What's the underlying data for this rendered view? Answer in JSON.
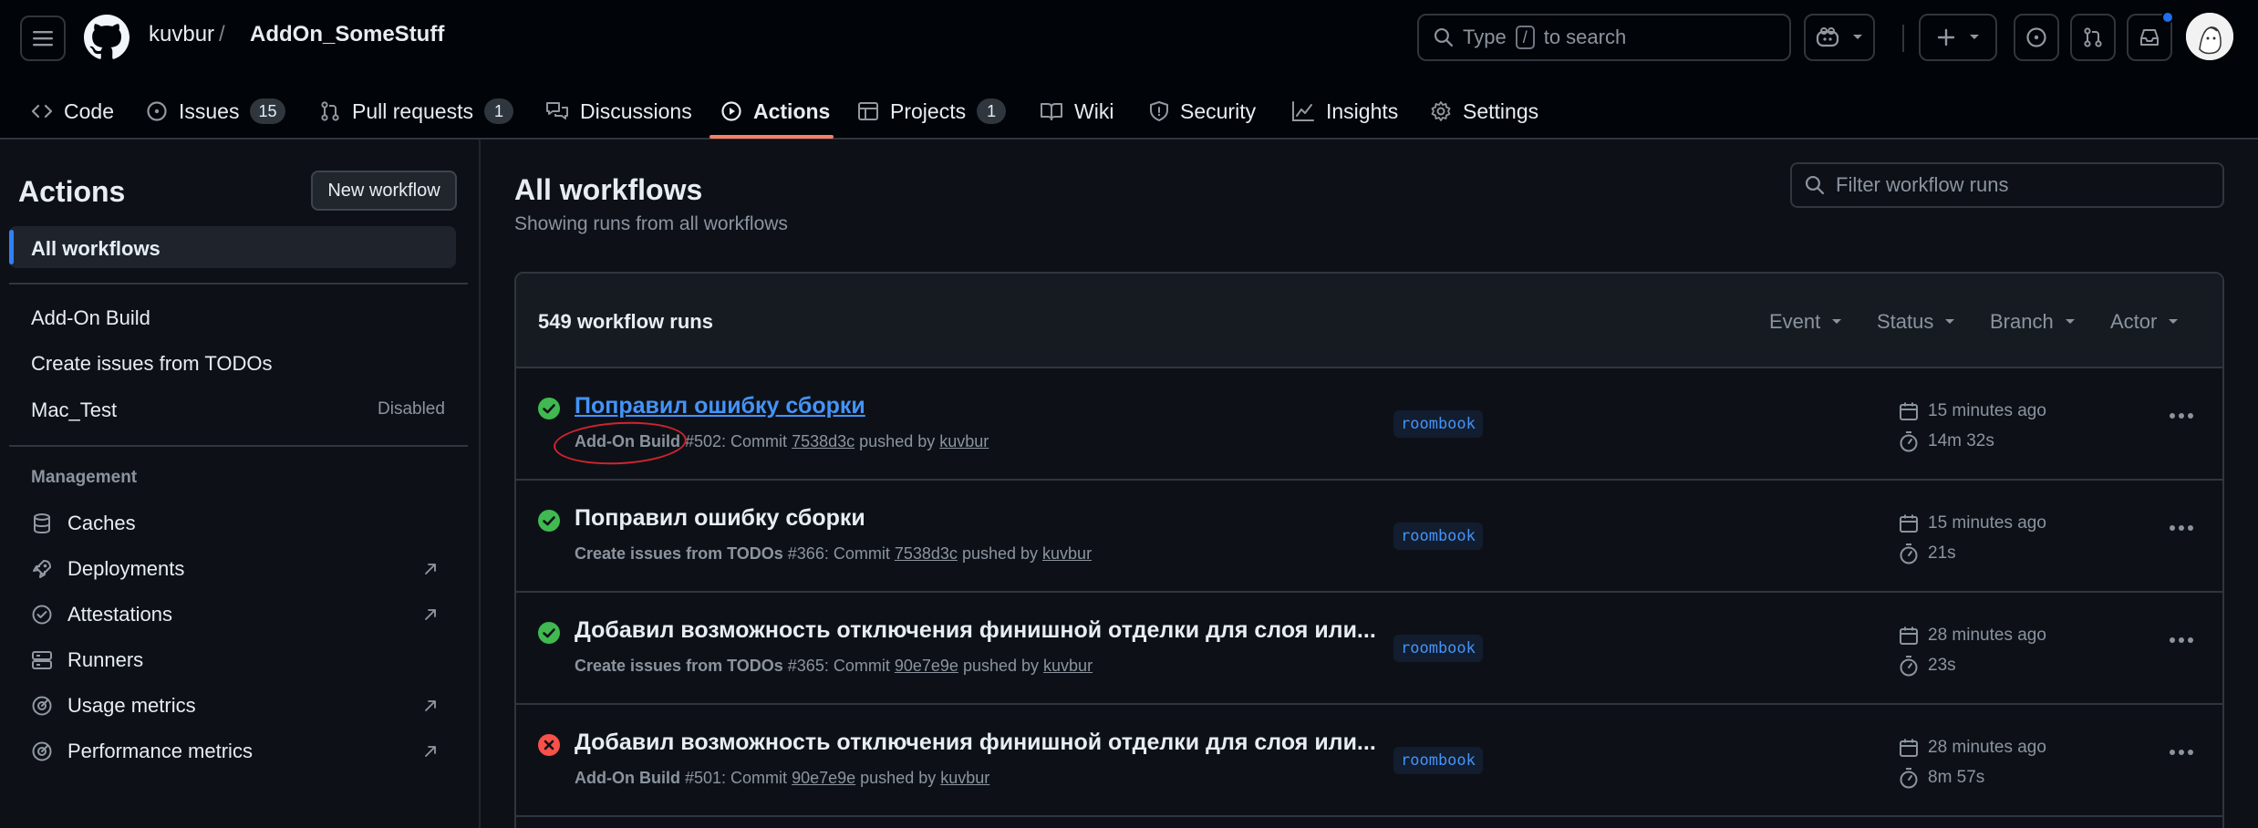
{
  "header": {
    "owner": "kuvbur",
    "separator": "/",
    "repo": "AddOn_SomeStuff",
    "search_prefix": "Type",
    "search_key": "/",
    "search_suffix": "to search"
  },
  "tabs": [
    {
      "label": "Code",
      "icon": "code-icon"
    },
    {
      "label": "Issues",
      "icon": "issue-icon",
      "count": "15"
    },
    {
      "label": "Pull requests",
      "icon": "pull-request-icon",
      "count": "1"
    },
    {
      "label": "Discussions",
      "icon": "discussions-icon"
    },
    {
      "label": "Actions",
      "icon": "play-icon",
      "active": true
    },
    {
      "label": "Projects",
      "icon": "table-icon",
      "count": "1"
    },
    {
      "label": "Wiki",
      "icon": "book-icon"
    },
    {
      "label": "Security",
      "icon": "shield-icon"
    },
    {
      "label": "Insights",
      "icon": "graph-icon"
    },
    {
      "label": "Settings",
      "icon": "gear-icon"
    }
  ],
  "sidebar": {
    "title": "Actions",
    "new_workflow": "New workflow",
    "all_workflows": "All workflows",
    "workflows": [
      {
        "label": "Add-On Build"
      },
      {
        "label": "Create issues from TODOs"
      },
      {
        "label": "Mac_Test",
        "status": "Disabled"
      }
    ],
    "management_title": "Management",
    "management": [
      {
        "label": "Caches",
        "icon": "database-icon"
      },
      {
        "label": "Deployments",
        "icon": "rocket-icon",
        "external": true
      },
      {
        "label": "Attestations",
        "icon": "verified-icon",
        "external": true
      },
      {
        "label": "Runners",
        "icon": "server-icon"
      },
      {
        "label": "Usage metrics",
        "icon": "meter-icon",
        "external": true
      },
      {
        "label": "Performance metrics",
        "icon": "meter-icon",
        "external": true
      }
    ]
  },
  "main": {
    "title": "All workflows",
    "subtitle": "Showing runs from all workflows",
    "filter_placeholder": "Filter workflow runs",
    "runs_count": "549 workflow runs",
    "filters": [
      "Event",
      "Status",
      "Branch",
      "Actor"
    ]
  },
  "runs": [
    {
      "status": "success",
      "title": "Поправил ошибку сборки",
      "workflow": "Add-On Build",
      "number": "#502",
      "commit_prefix": ": Commit",
      "commit": "7538d3c",
      "pushed_by": "pushed by",
      "actor": "kuvbur",
      "branch": "roombook",
      "time_ago": "15 minutes ago",
      "duration": "14m 32s"
    },
    {
      "status": "success",
      "title": "Поправил ошибку сборки",
      "workflow": "Create issues from TODOs",
      "number": "#366",
      "commit_prefix": ": Commit",
      "commit": "7538d3c",
      "pushed_by": "pushed by",
      "actor": "kuvbur",
      "branch": "roombook",
      "time_ago": "15 minutes ago",
      "duration": "21s"
    },
    {
      "status": "success",
      "title": "Добавил возможность отключения финишной отделки для слоя или...",
      "workflow": "Create issues from TODOs",
      "number": "#365",
      "commit_prefix": ": Commit",
      "commit": "90e7e9e",
      "pushed_by": "pushed by",
      "actor": "kuvbur",
      "branch": "roombook",
      "time_ago": "28 minutes ago",
      "duration": "23s"
    },
    {
      "status": "failure",
      "title": "Добавил возможность отключения финишной отделки для слоя или...",
      "workflow": "Add-On Build",
      "number": "#501",
      "commit_prefix": ": Commit",
      "commit": "90e7e9e",
      "pushed_by": "pushed by",
      "actor": "kuvbur",
      "branch": "roombook",
      "time_ago": "28 minutes ago",
      "duration": "8m 57s"
    }
  ],
  "colors": {
    "success": "#3fb950",
    "failure": "#f85149",
    "link": "#4493f8",
    "tab_underline": "#f78166",
    "annotation": "#d1242f"
  }
}
